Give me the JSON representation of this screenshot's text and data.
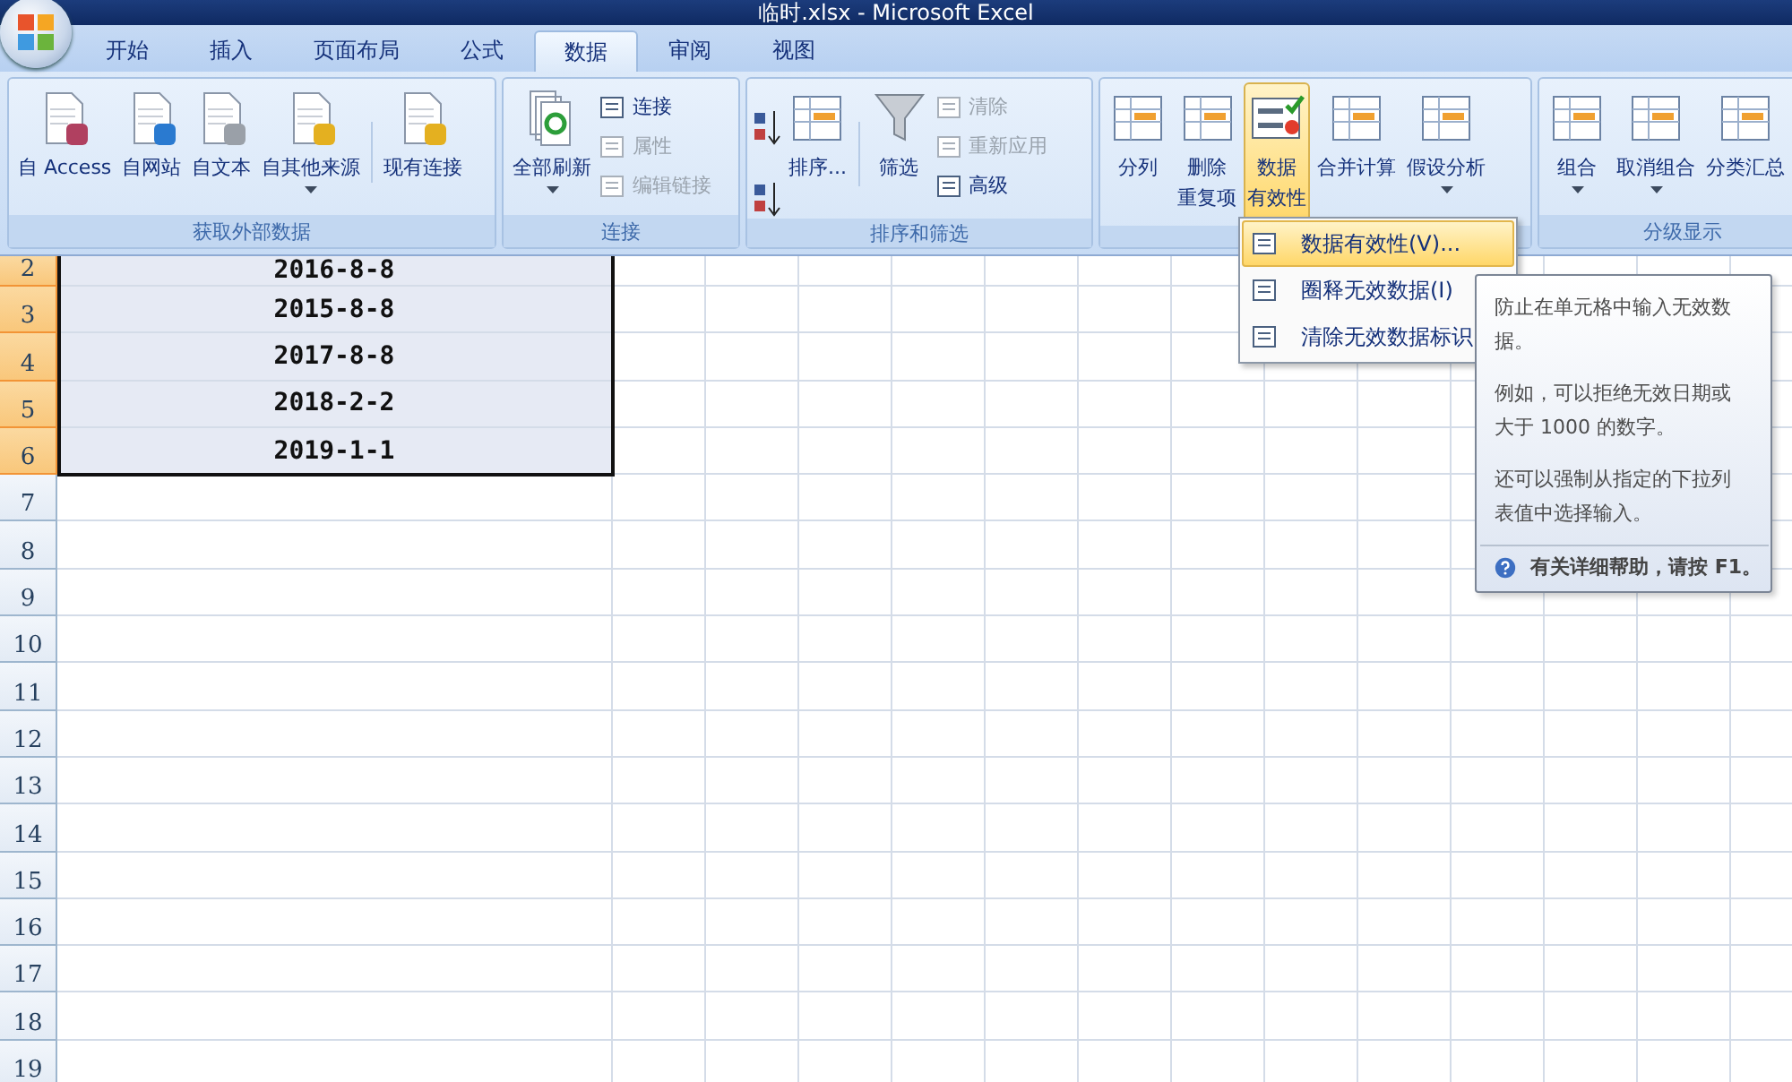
{
  "window": {
    "title": "临时.xlsx - Microsoft Excel"
  },
  "tabs": [
    {
      "label": "开始",
      "selected": false
    },
    {
      "label": "插入",
      "selected": false
    },
    {
      "label": "页面布局",
      "selected": false
    },
    {
      "label": "公式",
      "selected": false
    },
    {
      "label": "数据",
      "selected": true
    },
    {
      "label": "审阅",
      "selected": false
    },
    {
      "label": "视图",
      "selected": false
    }
  ],
  "ribbon": {
    "groups": [
      {
        "label": "获取外部数据",
        "buttons": [
          {
            "kind": "large",
            "label": "自 Access",
            "dropdown": false,
            "active": false,
            "disabled": false
          },
          {
            "kind": "large",
            "label": "自网站",
            "dropdown": false,
            "active": false,
            "disabled": false
          },
          {
            "kind": "large",
            "label": "自文本",
            "dropdown": false,
            "active": false,
            "disabled": false
          },
          {
            "kind": "large",
            "label": "自其他来源",
            "dropdown": true,
            "active": false,
            "disabled": false
          },
          {
            "kind": "separator"
          },
          {
            "kind": "large",
            "label": "现有连接",
            "dropdown": false,
            "active": false,
            "disabled": false
          }
        ]
      },
      {
        "label": "连接",
        "buttons": [
          {
            "kind": "large",
            "label": "全部刷新",
            "dropdown": true,
            "active": false,
            "disabled": false
          },
          {
            "kind": "stack",
            "items": [
              {
                "label": "连接",
                "disabled": false
              },
              {
                "label": "属性",
                "disabled": true
              },
              {
                "label": "编辑链接",
                "disabled": true
              }
            ]
          }
        ]
      },
      {
        "label": "排序和筛选",
        "buttons": [
          {
            "kind": "sortpair"
          },
          {
            "kind": "large",
            "label": "排序...",
            "dropdown": false,
            "active": false,
            "disabled": false
          },
          {
            "kind": "separator"
          },
          {
            "kind": "large",
            "label": "筛选",
            "dropdown": false,
            "active": false,
            "disabled": false
          },
          {
            "kind": "stack",
            "items": [
              {
                "label": "清除",
                "disabled": true
              },
              {
                "label": "重新应用",
                "disabled": true
              },
              {
                "label": "高级",
                "disabled": false
              }
            ]
          }
        ]
      },
      {
        "buttons": [
          {
            "kind": "large",
            "label": "分列",
            "dropdown": false,
            "active": false,
            "disabled": false
          },
          {
            "kind": "large",
            "lines": [
              "删除",
              "重复项"
            ],
            "dropdown": false,
            "active": false,
            "disabled": false
          },
          {
            "kind": "large",
            "lines": [
              "数据",
              "有效性"
            ],
            "dropdown": true,
            "active": true,
            "disabled": false
          },
          {
            "kind": "large",
            "label": "合并计算",
            "dropdown": false,
            "active": false,
            "disabled": false
          },
          {
            "kind": "large",
            "label": "假设分析",
            "dropdown": true,
            "active": false,
            "disabled": false
          }
        ]
      },
      {
        "label": "分级显示",
        "buttons": [
          {
            "kind": "large",
            "label": "组合",
            "dropdown": true,
            "active": false,
            "disabled": false
          },
          {
            "kind": "large",
            "label": "取消组合",
            "dropdown": true,
            "active": false,
            "disabled": false
          },
          {
            "kind": "large",
            "label": "分类汇总",
            "dropdown": false,
            "active": false,
            "disabled": false
          }
        ]
      }
    ]
  },
  "menu": {
    "items": [
      {
        "label": "数据有效性(V)...",
        "selected": true
      },
      {
        "label": "圈释无效数据(I)",
        "selected": false
      },
      {
        "label": "清除无效数据标识",
        "selected": false
      }
    ]
  },
  "tooltip": {
    "paragraphs": [
      "防止在单元格中输入无效数据。",
      "例如，可以拒绝无效日期或大于 1000 的数字。",
      "还可以强制从指定的下拉列表值中选择输入。"
    ],
    "help": "有关详细帮助，请按 F1。"
  },
  "sheet": {
    "rows": [
      {
        "header": "2",
        "value": "2016-8-8",
        "selected": true
      },
      {
        "header": "3",
        "value": "2015-8-8",
        "selected": true
      },
      {
        "header": "4",
        "value": "2017-8-8",
        "selected": true
      },
      {
        "header": "5",
        "value": "2018-2-2",
        "selected": true
      },
      {
        "header": "6",
        "value": "2019-1-1",
        "selected": true
      },
      {
        "header": "7",
        "selected": false
      },
      {
        "header": "8",
        "selected": false
      },
      {
        "header": "9",
        "selected": false
      },
      {
        "header": "10",
        "selected": false
      },
      {
        "header": "11",
        "selected": false
      },
      {
        "header": "12",
        "selected": false
      },
      {
        "header": "13",
        "selected": false
      },
      {
        "header": "14",
        "selected": false
      },
      {
        "header": "15",
        "selected": false
      },
      {
        "header": "16",
        "selected": false
      },
      {
        "header": "17",
        "selected": false
      },
      {
        "header": "18",
        "selected": false
      },
      {
        "header": "19",
        "selected": false
      }
    ]
  }
}
